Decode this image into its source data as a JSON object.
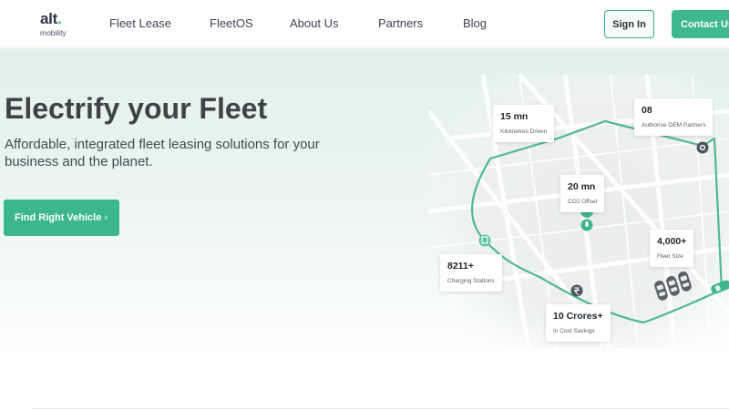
{
  "brand": {
    "name": "alt",
    "dot": ".",
    "sub": "mobility"
  },
  "nav": {
    "links": [
      "Fleet Lease",
      "FleetOS",
      "About Us",
      "Partners",
      "Blog"
    ],
    "signin_label": "Sign In",
    "contact_label": "Contact Us"
  },
  "hero": {
    "title": "Electrify your Fleet",
    "subtitle": "Affordable, integrated fleet leasing solutions for your business and the planet.",
    "cta_label": "Find Right Vehicle",
    "cta_chevron": "›"
  },
  "stats": [
    {
      "value": "15 mn",
      "label": "Kilometres Driven"
    },
    {
      "value": "08",
      "label": "Authorise OEM Partners"
    },
    {
      "value": "20 mn",
      "label": "CO2 Offset"
    },
    {
      "value": "4,000+",
      "label": "Fleet Size"
    },
    {
      "value": "8211+",
      "label": "Charging Stations"
    },
    {
      "value": "10 Crores+",
      "label": "In Cost Savings"
    }
  ],
  "colors": {
    "accent": "#3cb68d",
    "route": "#4fb98f",
    "hero_background": "#e1f2ea",
    "heading": "#3e4348"
  },
  "icons": [
    "settings-pin-icon",
    "leaf-pin-icon",
    "charging-station-icon",
    "rupee-pin-icon",
    "car-icon"
  ]
}
